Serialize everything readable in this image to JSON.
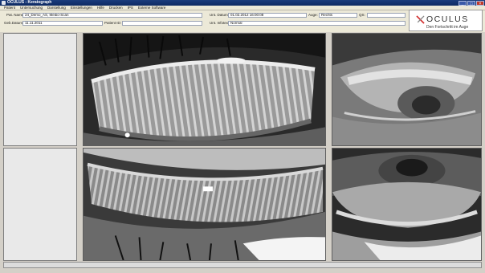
{
  "window": {
    "title": "OCULUS - Keratograph",
    "buttons": {
      "minimize": "_",
      "maximize": "□",
      "close": "×"
    }
  },
  "menu": [
    "Patient",
    "Untersuchung",
    "Darstellung",
    "Einstellungen",
    "Hilfe",
    "Drucken",
    "IPS",
    "Externe Software"
  ],
  "patient": {
    "name_label": "Pat. Name:",
    "name_value": "24_Demo_AS, Meibo-Scan",
    "birth_label": "Geb.Datum:",
    "birth_value": "11.11.2011",
    "id_label": "Patient ID:",
    "id_value": ""
  },
  "exam": {
    "date_label": "Unt. Datum:",
    "date_value": "01.02.2012 16:00:08",
    "eye_label": "Auge:",
    "eye_value": "Rechts",
    "qs_label": "QS:",
    "qs_value": "",
    "info_label": "Unt. Infotext:",
    "info_value": "Normal"
  },
  "logo": {
    "brand": "OCULUS",
    "slogan": "Den Fortschritt im Auge",
    "colors": {
      "mark_red": "#d22a2a",
      "mark_gray": "#888888",
      "text": "#333333"
    }
  },
  "images": {
    "top_left": "meibography-upper-lid-infrared",
    "top_right": "eye-upper-lid-view",
    "bottom_left": "meibography-lower-lid-infrared",
    "bottom_right": "eye-lower-lid-view"
  }
}
